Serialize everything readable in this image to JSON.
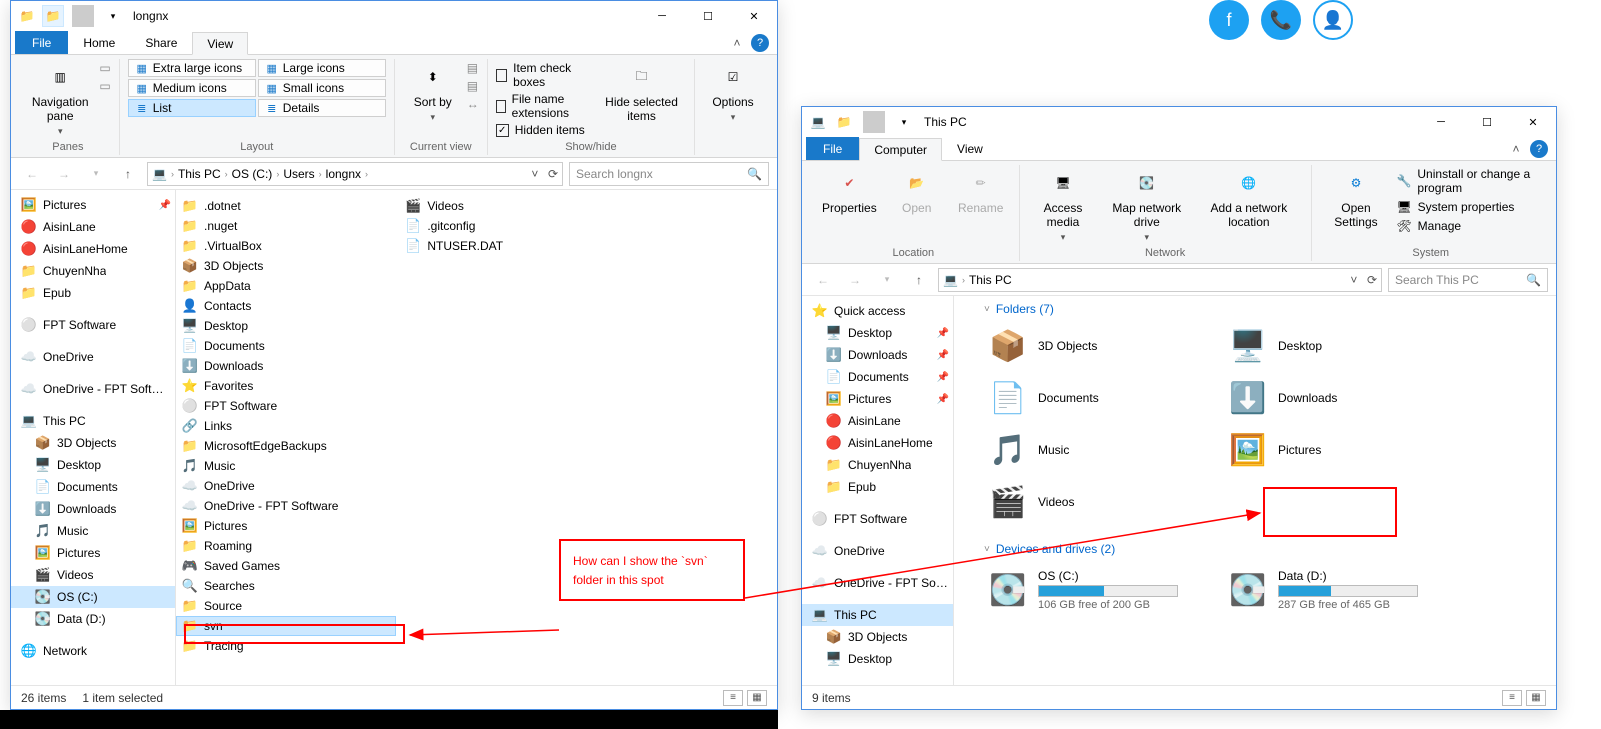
{
  "win1": {
    "title": "longnx",
    "tabs": {
      "file": "File",
      "home": "Home",
      "share": "Share",
      "view": "View"
    },
    "ribbon": {
      "panes": {
        "nav": "Navigation pane",
        "label": "Panes"
      },
      "layout": {
        "label": "Layout",
        "opts": [
          "Extra large icons",
          "Large icons",
          "Medium icons",
          "Small icons",
          "List",
          "Details"
        ]
      },
      "sortby": "Sort by",
      "curview": "Current view",
      "showhide": {
        "label": "Show/hide",
        "chk": [
          "Item check boxes",
          "File name extensions",
          "Hidden items"
        ],
        "hidesel": "Hide selected items"
      },
      "options": "Options"
    },
    "breadcrumb": [
      "This PC",
      "OS (C:)",
      "Users",
      "longnx"
    ],
    "search_ph": "Search longnx",
    "tree": [
      {
        "icon": "🖼️",
        "label": "Pictures",
        "pin": true
      },
      {
        "icon": "🔴",
        "label": "AisinLane"
      },
      {
        "icon": "🔴",
        "label": "AisinLaneHome"
      },
      {
        "icon": "📁",
        "label": "ChuyenNha"
      },
      {
        "icon": "📁",
        "label": "Epub"
      },
      {
        "gap": true
      },
      {
        "icon": "⚪",
        "label": "FPT Software",
        "color": "#777"
      },
      {
        "gap": true
      },
      {
        "icon": "☁️",
        "label": "OneDrive",
        "color": "#0078d4"
      },
      {
        "gap": true
      },
      {
        "icon": "☁️",
        "label": "OneDrive - FPT Software",
        "color": "#0078d4"
      },
      {
        "gap": true
      },
      {
        "icon": "💻",
        "label": "This PC",
        "color": "#0078d4"
      },
      {
        "icon": "📦",
        "label": "3D Objects",
        "lvl": 1
      },
      {
        "icon": "🖥️",
        "label": "Desktop",
        "lvl": 1
      },
      {
        "icon": "📄",
        "label": "Documents",
        "lvl": 1
      },
      {
        "icon": "⬇️",
        "label": "Downloads",
        "lvl": 1
      },
      {
        "icon": "🎵",
        "label": "Music",
        "lvl": 1
      },
      {
        "icon": "🖼️",
        "label": "Pictures",
        "lvl": 1
      },
      {
        "icon": "🎬",
        "label": "Videos",
        "lvl": 1
      },
      {
        "icon": "💽",
        "label": "OS (C:)",
        "lvl": 1,
        "sel": true
      },
      {
        "icon": "💽",
        "label": "Data (D:)",
        "lvl": 1
      },
      {
        "gap": true
      },
      {
        "icon": "🌐",
        "label": "Network",
        "color": "#0078d4"
      }
    ],
    "col1": [
      {
        "icon": "📁",
        "t": ".dotnet"
      },
      {
        "icon": "📁",
        "t": ".nuget"
      },
      {
        "icon": "📁",
        "t": ".VirtualBox"
      },
      {
        "icon": "📦",
        "t": "3D Objects"
      },
      {
        "icon": "📁",
        "t": "AppData"
      },
      {
        "icon": "👤",
        "t": "Contacts"
      },
      {
        "icon": "🖥️",
        "t": "Desktop"
      },
      {
        "icon": "📄",
        "t": "Documents"
      },
      {
        "icon": "⬇️",
        "t": "Downloads"
      },
      {
        "icon": "⭐",
        "t": "Favorites"
      },
      {
        "icon": "⚪",
        "t": "FPT Software"
      },
      {
        "icon": "🔗",
        "t": "Links"
      },
      {
        "icon": "📁",
        "t": "MicrosoftEdgeBackups"
      },
      {
        "icon": "🎵",
        "t": "Music"
      },
      {
        "icon": "☁️",
        "t": "OneDrive"
      },
      {
        "icon": "☁️",
        "t": "OneDrive - FPT Software"
      },
      {
        "icon": "🖼️",
        "t": "Pictures"
      },
      {
        "icon": "📁",
        "t": "Roaming"
      },
      {
        "icon": "🎮",
        "t": "Saved Games"
      },
      {
        "icon": "🔍",
        "t": "Searches"
      },
      {
        "icon": "📁",
        "t": "Source"
      },
      {
        "icon": "📁",
        "t": "svn",
        "sel": true
      },
      {
        "icon": "📁",
        "t": "Tracing"
      }
    ],
    "col2": [
      {
        "icon": "🎬",
        "t": "Videos"
      },
      {
        "icon": "📄",
        "t": ".gitconfig"
      },
      {
        "icon": "📄",
        "t": "NTUSER.DAT"
      }
    ],
    "status": {
      "items": "26 items",
      "selected": "1 item selected"
    }
  },
  "win2": {
    "title": "This PC",
    "tabs": {
      "file": "File",
      "computer": "Computer",
      "view": "View"
    },
    "ribbon": {
      "location": {
        "props": "Properties",
        "open": "Open",
        "rename": "Rename",
        "label": "Location"
      },
      "network": {
        "access": "Access media",
        "map": "Map network drive",
        "add": "Add a network location",
        "label": "Network"
      },
      "system": {
        "open": "Open Settings",
        "un": "Uninstall or change a program",
        "sp": "System properties",
        "mg": "Manage",
        "label": "System"
      }
    },
    "breadcrumb": [
      "This PC"
    ],
    "search_ph": "Search This PC",
    "tree": [
      {
        "icon": "⭐",
        "label": "Quick access",
        "color": "#0078d4"
      },
      {
        "icon": "🖥️",
        "label": "Desktop",
        "lvl": 1,
        "pin": true
      },
      {
        "icon": "⬇️",
        "label": "Downloads",
        "lvl": 1,
        "pin": true
      },
      {
        "icon": "📄",
        "label": "Documents",
        "lvl": 1,
        "pin": true
      },
      {
        "icon": "🖼️",
        "label": "Pictures",
        "lvl": 1,
        "pin": true
      },
      {
        "icon": "🔴",
        "label": "AisinLane",
        "lvl": 1
      },
      {
        "icon": "🔴",
        "label": "AisinLaneHome",
        "lvl": 1
      },
      {
        "icon": "📁",
        "label": "ChuyenNha",
        "lvl": 1
      },
      {
        "icon": "📁",
        "label": "Epub",
        "lvl": 1
      },
      {
        "gap": true
      },
      {
        "icon": "⚪",
        "label": "FPT Software",
        "color": "#777"
      },
      {
        "gap": true
      },
      {
        "icon": "☁️",
        "label": "OneDrive",
        "color": "#0078d4"
      },
      {
        "gap": true
      },
      {
        "icon": "☁️",
        "label": "OneDrive - FPT Software",
        "color": "#0078d4"
      },
      {
        "gap": true
      },
      {
        "icon": "💻",
        "label": "This PC",
        "color": "#0078d4",
        "sel": true
      },
      {
        "icon": "📦",
        "label": "3D Objects",
        "lvl": 1
      },
      {
        "icon": "🖥️",
        "label": "Desktop",
        "lvl": 1
      }
    ],
    "folders_hdr": "Folders (7)",
    "folders": [
      {
        "icon": "📦",
        "t": "3D Objects"
      },
      {
        "icon": "🖥️",
        "t": "Desktop"
      },
      {
        "icon": "📄",
        "t": "Documents"
      },
      {
        "icon": "⬇️",
        "t": "Downloads"
      },
      {
        "icon": "🎵",
        "t": "Music"
      },
      {
        "icon": "🖼️",
        "t": "Pictures"
      },
      {
        "icon": "🎬",
        "t": "Videos"
      }
    ],
    "devices_hdr": "Devices and drives (2)",
    "drives": [
      {
        "t": "OS (C:)",
        "free": "106 GB free of 200 GB",
        "pct": 47
      },
      {
        "t": "Data (D:)",
        "free": "287 GB free of 465 GB",
        "pct": 38
      }
    ],
    "status": {
      "items": "9 items"
    }
  },
  "annotation": "How can I show the `svn` folder in this spot"
}
